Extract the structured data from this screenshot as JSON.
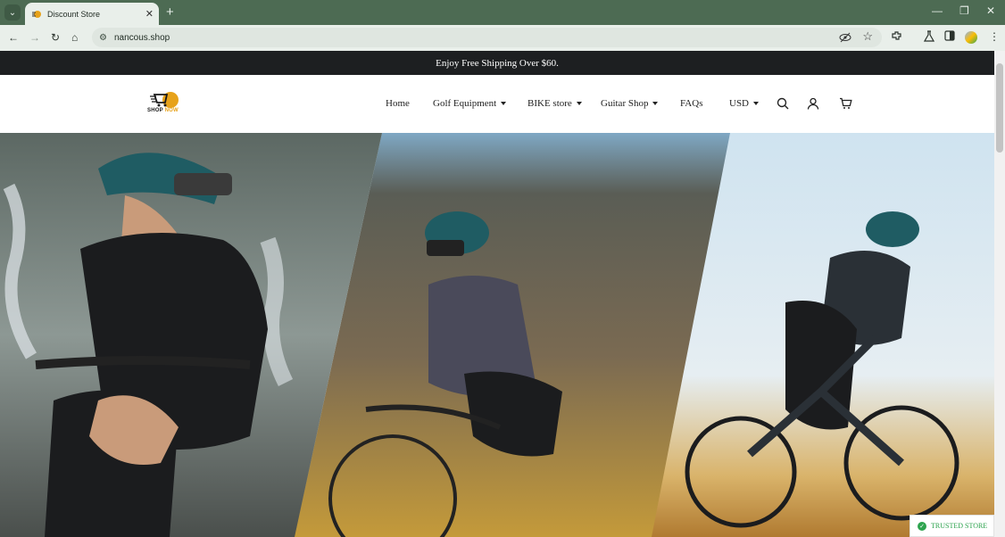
{
  "browser": {
    "tab_title": "Discount Store",
    "tab_close": "✕",
    "new_tab": "+",
    "url": "nancous.shop",
    "window": {
      "minimize": "—",
      "restore": "❐",
      "close": "✕"
    }
  },
  "announcement": "Enjoy Free Shipping Over $60.",
  "logo": {
    "text1": "SHOP",
    "text2": "NOW"
  },
  "nav": {
    "home": "Home",
    "golf": "Golf Equipment",
    "bike": "BIKE store",
    "guitar": "Guitar Shop",
    "faqs": "FAQs",
    "currency": "USD"
  },
  "icons": [
    "search-icon",
    "account-icon",
    "cart-icon"
  ],
  "badge": "TRUSTED STORE",
  "colors": {
    "chrome": "#4d6b53",
    "announce_bg": "#1d1f21",
    "badge_green": "#2ea44f"
  }
}
